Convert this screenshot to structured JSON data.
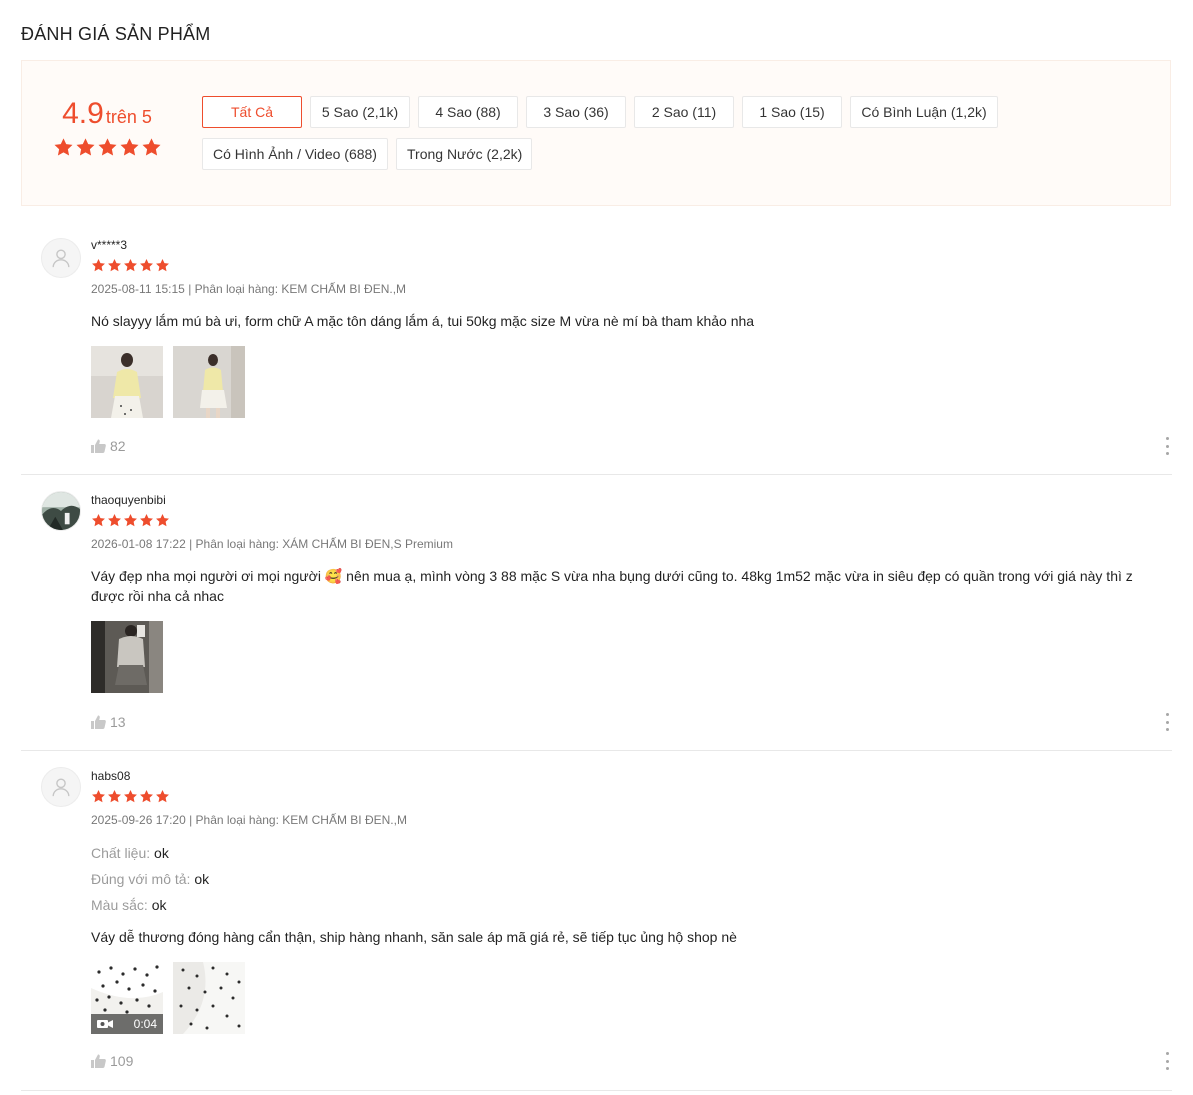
{
  "section_title": "ĐÁNH GIÁ SẢN PHẨM",
  "overview": {
    "score": "4.9",
    "score_suffix": "trên 5",
    "star_count": 5,
    "filters": [
      {
        "label": "Tất Cả",
        "active": true
      },
      {
        "label": "5 Sao (2,1k)",
        "active": false
      },
      {
        "label": "4 Sao (88)",
        "active": false
      },
      {
        "label": "3 Sao (36)",
        "active": false
      },
      {
        "label": "2 Sao (11)",
        "active": false
      },
      {
        "label": "1 Sao (15)",
        "active": false
      },
      {
        "label": "Có Bình Luận (1,2k)",
        "active": false
      },
      {
        "label": "Có Hình Ảnh / Video (688)",
        "active": false
      },
      {
        "label": "Trong Nước (2,2k)",
        "active": false
      }
    ]
  },
  "reviews": [
    {
      "username": "v*****3",
      "rating": 5,
      "meta": "2025-08-11 15:15 | Phân loại hàng: KEM CHẤM BI ĐEN.,M",
      "content": "Nó slayyy lắm mú bà ưi, form chữ A mặc tôn dáng lắm á, tui 50kg mặc size M vừa nè mí bà tham khảo nha",
      "likes": "82"
    },
    {
      "username": "thaoquyenbibi",
      "rating": 5,
      "meta": "2026-01-08 17:22 | Phân loại hàng: XÁM CHẤM BI ĐEN,S Premium",
      "content": "Váy đẹp nha mọi người ơi mọi người 🥰 nên mua ạ, mình vòng 3 88 mặc S vừa nha bụng dưới cũng to. 48kg 1m52 mặc vừa in siêu đẹp có quần trong với giá này thì z được rồi nha cả nhac",
      "likes": "13"
    },
    {
      "username": "habs08",
      "rating": 5,
      "meta": "2025-09-26 17:20 | Phân loại hàng: KEM CHẤM BI ĐEN.,M",
      "attributes": [
        {
          "key": "Chất liệu:",
          "value": "ok"
        },
        {
          "key": "Đúng với mô tả:",
          "value": "ok"
        },
        {
          "key": "Màu sắc:",
          "value": "ok"
        }
      ],
      "content": "Váy dễ thương đóng hàng cẩn thận, ship hàng nhanh, săn sale áp mã giá rẻ, sẽ tiếp tục ủng hộ shop nè",
      "video_duration": "0:04",
      "likes": "109"
    }
  ],
  "colors": {
    "accent": "#ee4d2d",
    "overview_bg": "#fffbf8",
    "muted_text": "#8a8a8a"
  },
  "icons": [
    "star-icon",
    "user-placeholder-icon",
    "thumbs-up-icon",
    "more-vertical-icon",
    "video-camera-icon"
  ]
}
